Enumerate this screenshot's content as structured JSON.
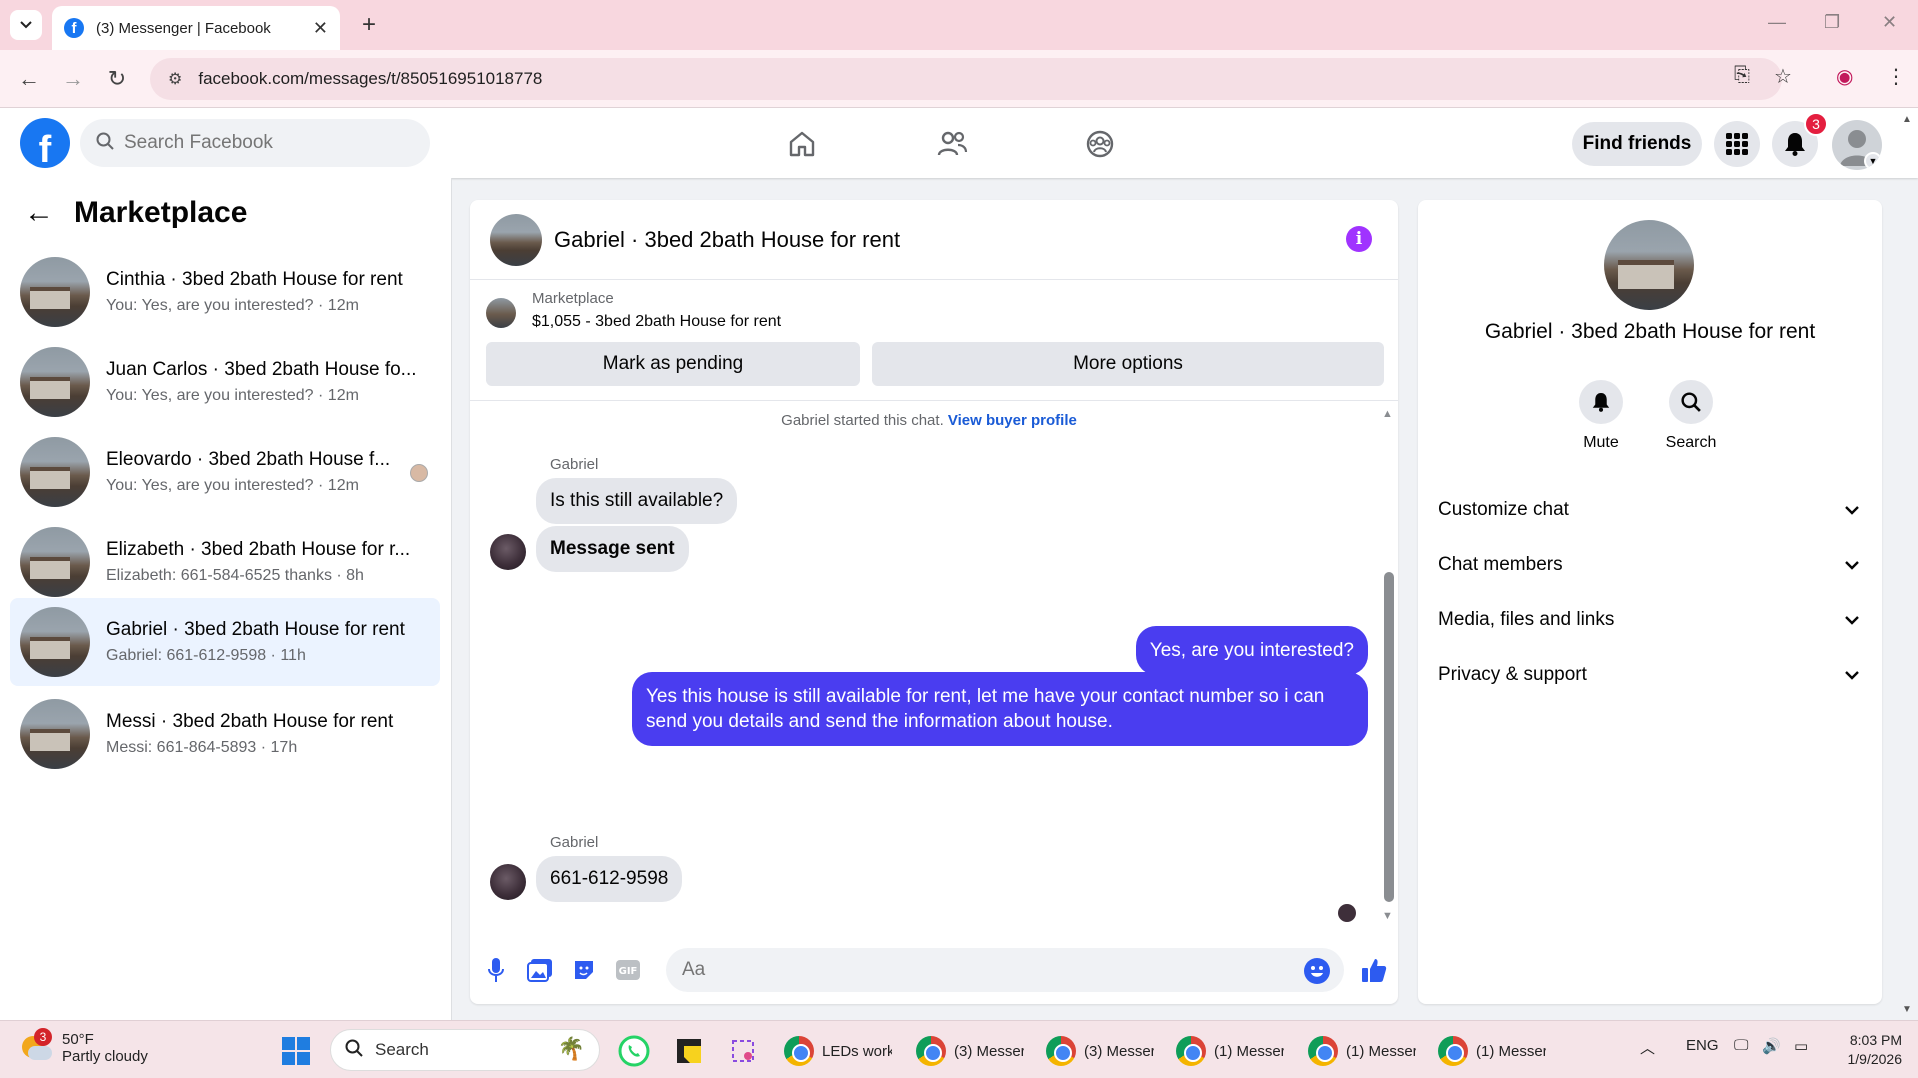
{
  "browser": {
    "tab_title": "(3) Messenger | Facebook",
    "url": "facebook.com/messages/t/850516951018778"
  },
  "fb": {
    "search_placeholder": "Search Facebook",
    "find_friends": "Find friends",
    "notification_count": "3"
  },
  "left": {
    "title": "Marketplace",
    "conversations": [
      {
        "name": "Cinthia · 3bed 2bath House for rent",
        "preview": "You: Yes, are you interested? · 12m"
      },
      {
        "name": "Juan Carlos · 3bed 2bath House fo...",
        "preview": "You: Yes, are you interested? · 12m"
      },
      {
        "name": "Eleovardo · 3bed 2bath House f...",
        "preview": "You: Yes, are you interested? · 12m"
      },
      {
        "name": "Elizabeth · 3bed 2bath House for r...",
        "preview": "Elizabeth: 661-584-6525 thanks · 8h"
      },
      {
        "name": "Gabriel · 3bed 2bath House for rent",
        "preview": "Gabriel: 661-612-9598 · 11h"
      },
      {
        "name": "Messi · 3bed 2bath House for rent",
        "preview": "Messi: 661-864-5893 · 17h"
      }
    ]
  },
  "chat": {
    "title": "Gabriel · 3bed 2bath House for rent",
    "marketplace_label": "Marketplace",
    "listing": "$1,055 - 3bed 2bath House for rent",
    "mark_pending": "Mark as pending",
    "more_options": "More options",
    "started_text": "Gabriel started this chat.",
    "view_profile": "View buyer profile",
    "sender": "Gabriel",
    "msg1": "Is this still available?",
    "msg2": "Message sent",
    "out1": "Yes, are you interested?",
    "out2_line1": "Yes this house is still available for rent, let me have your contact number so i can",
    "out2_line2": "send you details and send the information about house.",
    "sender2": "Gabriel",
    "msg3": "661-612-9598",
    "composer_placeholder": "Aa"
  },
  "right": {
    "name": "Gabriel · 3bed 2bath House for rent",
    "mute": "Mute",
    "search": "Search",
    "sections": [
      "Customize chat",
      "Chat members",
      "Media, files and links",
      "Privacy & support"
    ]
  },
  "taskbar": {
    "weather_badge": "3",
    "temp": "50°F",
    "weather_desc": "Partly cloudy",
    "search": "Search",
    "apps": [
      "LEDs work",
      "(3) Messer",
      "(3) Messer",
      "(1) Messer",
      "(1) Messer",
      "(1) Messer"
    ],
    "lang": "ENG",
    "time": "8:03 PM",
    "date": "1/9/2026"
  }
}
